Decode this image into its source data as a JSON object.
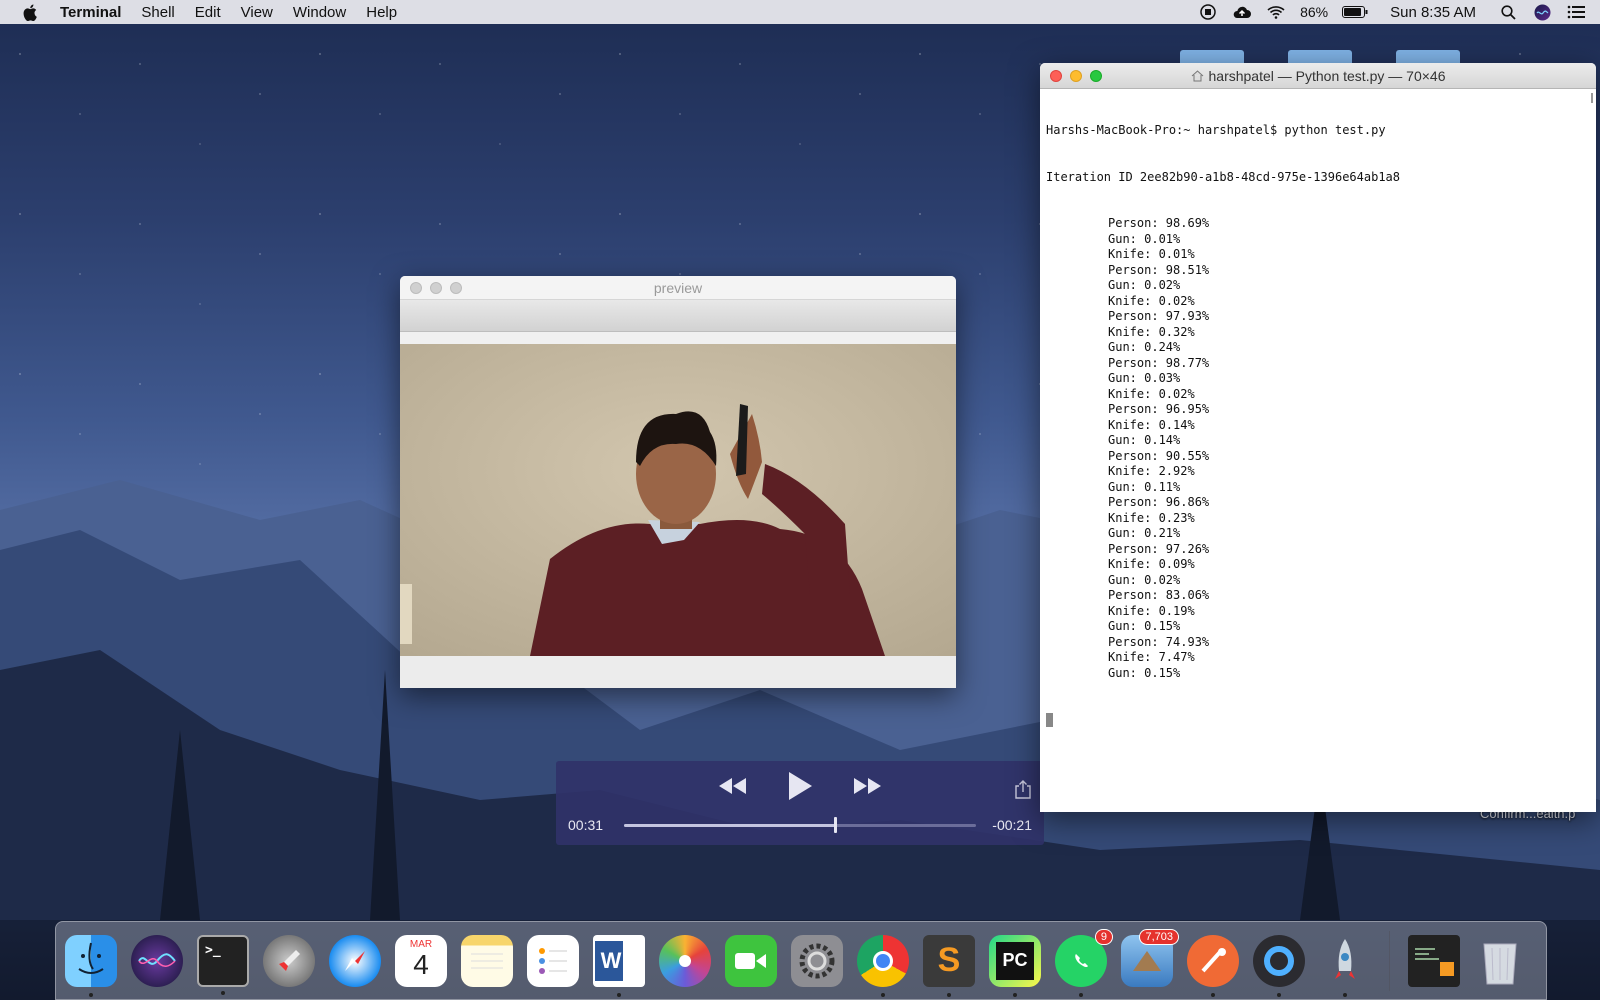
{
  "menubar": {
    "app_name": "Terminal",
    "menus": [
      "Shell",
      "Edit",
      "View",
      "Window",
      "Help"
    ],
    "battery": "86%",
    "clock": "Sun 8:35 AM"
  },
  "terminal": {
    "title": "harshpatel — Python test.py — 70×46",
    "prompt": "Harshs-MacBook-Pro:~ harshpatel$ python test.py",
    "iteration": "Iteration ID 2ee82b90-a1b8-48cd-975e-1396e64ab1a8",
    "lines": [
      "Person: 98.69%",
      "Gun: 0.01%",
      "Knife: 0.01%",
      "Person: 98.51%",
      "Gun: 0.02%",
      "Knife: 0.02%",
      "Person: 97.93%",
      "Knife: 0.32%",
      "Gun: 0.24%",
      "Person: 98.77%",
      "Gun: 0.03%",
      "Knife: 0.02%",
      "Person: 96.95%",
      "Knife: 0.14%",
      "Gun: 0.14%",
      "Person: 90.55%",
      "Knife: 2.92%",
      "Gun: 0.11%",
      "Person: 96.86%",
      "Knife: 0.23%",
      "Gun: 0.21%",
      "Person: 97.26%",
      "Knife: 0.09%",
      "Gun: 0.02%",
      "Person: 83.06%",
      "Knife: 0.19%",
      "Gun: 0.15%",
      "Person: 74.93%",
      "Knife: 7.47%",
      "Gun: 0.15%"
    ]
  },
  "preview": {
    "title": "preview"
  },
  "player": {
    "elapsed": "00:31",
    "remaining": "-00:21",
    "progress": 0.6
  },
  "desktop": {
    "file_label": "Confirm...ealth.p"
  },
  "dock": {
    "calendar_month": "MAR",
    "calendar_day": "4",
    "whatsapp_badge": "9",
    "mail_badge": "7,703"
  }
}
